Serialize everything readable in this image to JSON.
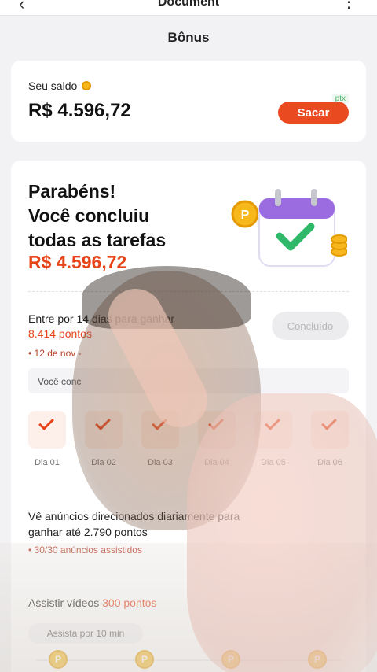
{
  "topbar": {
    "title": "Document",
    "back_icon": "back-arrow-icon",
    "more_icon": "more-icon"
  },
  "page": {
    "title": "Bônus"
  },
  "balance": {
    "label": "Seu saldo",
    "value": "R$ 4.596,72",
    "withdraw_label": "Sacar",
    "badge": "ptx"
  },
  "congrats": {
    "lines": [
      "Parabéns!",
      "Você concluiu",
      "todas as tarefas"
    ],
    "amount": "R$ 4.596,72"
  },
  "checkin": {
    "title": "Entre por 14 dias para ganhar",
    "points": "8.414 pontos",
    "date": "• 12 de nov -",
    "done_label": "Concluído",
    "note": "Você conc",
    "days": [
      "Dia 01",
      "Dia 02",
      "Dia 03",
      "Dia 04",
      "Dia 05",
      "Dia 06"
    ]
  },
  "ads": {
    "title": "Vê anúncios direcionados diariamente para ganhar até 2.790 pontos",
    "progress": "• 30/30 anúncios assistidos"
  },
  "videos": {
    "title": "Assistir vídeos",
    "points": "300 pontos",
    "watch_label": "Assista por 10 min",
    "coins": [
      "P",
      "P",
      "P",
      "P"
    ]
  },
  "colors": {
    "accent": "#ea4a1f",
    "coin": "#f6b81c",
    "background": "#f2f2f4"
  }
}
